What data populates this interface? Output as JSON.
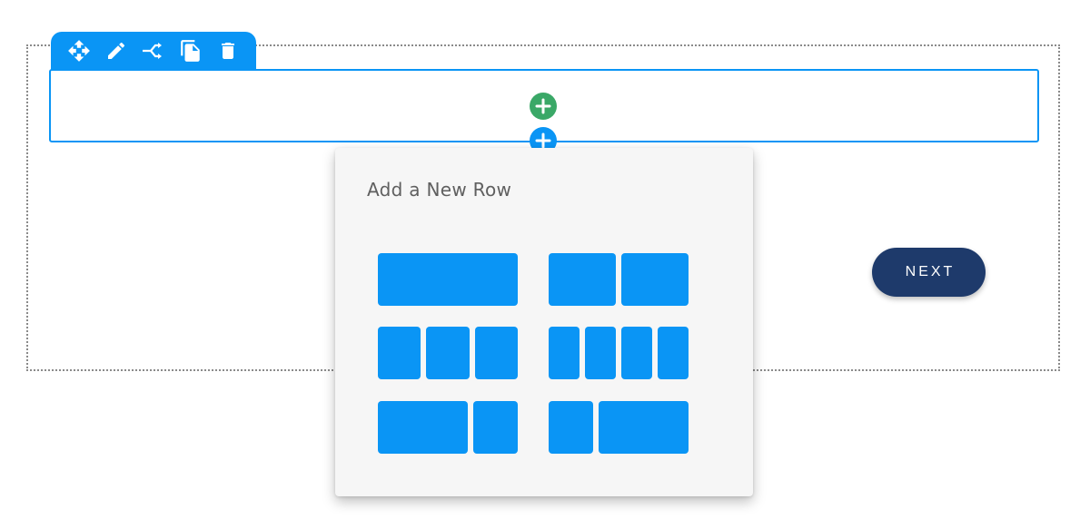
{
  "toolbar": {
    "tools": [
      {
        "icon": "move-icon"
      },
      {
        "icon": "pencil-icon"
      },
      {
        "icon": "branch-icon"
      },
      {
        "icon": "duplicate-icon"
      },
      {
        "icon": "trash-icon"
      }
    ]
  },
  "popup": {
    "title": "Add a New Row",
    "layouts": [
      {
        "name": "one-column",
        "columns": [
          1
        ]
      },
      {
        "name": "two-columns",
        "columns": [
          1,
          1
        ]
      },
      {
        "name": "three-columns",
        "columns": [
          1,
          1,
          1
        ]
      },
      {
        "name": "four-columns",
        "columns": [
          1,
          1,
          1,
          1
        ]
      },
      {
        "name": "two-thirds-one-third",
        "columns": [
          2,
          1
        ]
      },
      {
        "name": "one-third-two-thirds",
        "columns": [
          1,
          2
        ]
      }
    ]
  },
  "next_button": {
    "label": "NEXT"
  },
  "colors": {
    "accent": "#0a95f5",
    "add_column": "#3aa867",
    "next_button": "#1e3a6b",
    "popup_bg": "#f6f6f6"
  }
}
